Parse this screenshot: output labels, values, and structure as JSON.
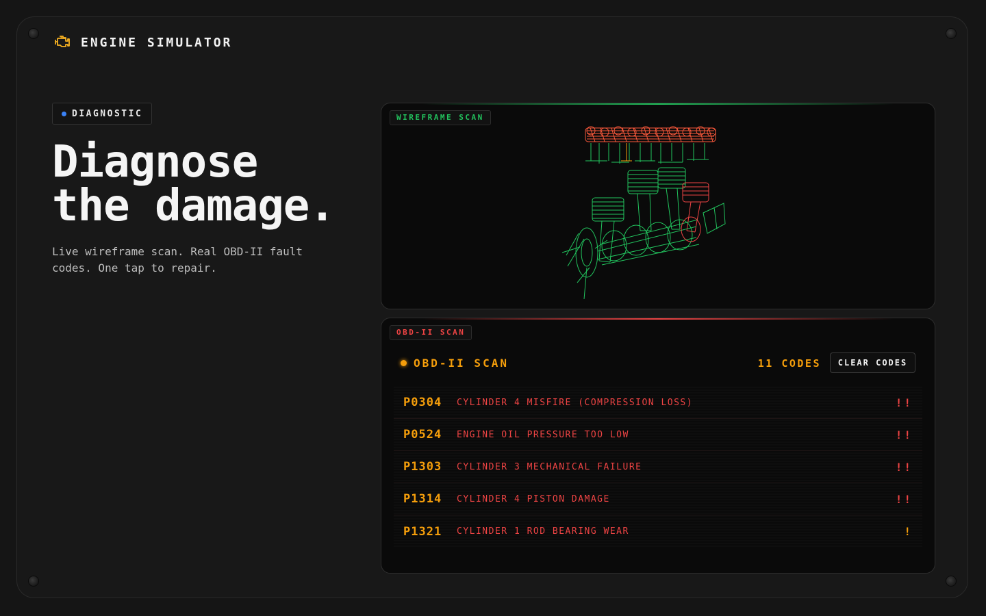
{
  "app": {
    "title": "ENGINE SIMULATOR",
    "icon": "check-engine-icon",
    "accent": "#f5b021"
  },
  "hero": {
    "badge": "DIAGNOSTIC",
    "badge_dot_color": "#3b82f6",
    "heading_line1": "Diagnose",
    "heading_line2": "the damage.",
    "subtitle": "Live wireframe scan. Real OBD-II fault codes. One tap to repair."
  },
  "wireframe_panel": {
    "tag": "WIREFRAME SCAN",
    "healthy_color": "#22c55e",
    "damaged_color": "#ef4444"
  },
  "obd_panel": {
    "tag": "OBD-II SCAN",
    "heading": "OBD-II SCAN",
    "count": "11 CODES",
    "clear_label": "CLEAR CODES",
    "codes": [
      {
        "code": "P0304",
        "description": "CYLINDER 4 MISFIRE (COMPRESSION LOSS)",
        "severity": "!!",
        "level": "high"
      },
      {
        "code": "P0524",
        "description": "ENGINE OIL PRESSURE TOO LOW",
        "severity": "!!",
        "level": "high"
      },
      {
        "code": "P1303",
        "description": "CYLINDER 3 MECHANICAL FAILURE",
        "severity": "!!",
        "level": "high"
      },
      {
        "code": "P1314",
        "description": "CYLINDER 4 PISTON DAMAGE",
        "severity": "!!",
        "level": "high"
      },
      {
        "code": "P1321",
        "description": "CYLINDER 1 ROD BEARING WEAR",
        "severity": "!",
        "level": "medium"
      }
    ]
  }
}
